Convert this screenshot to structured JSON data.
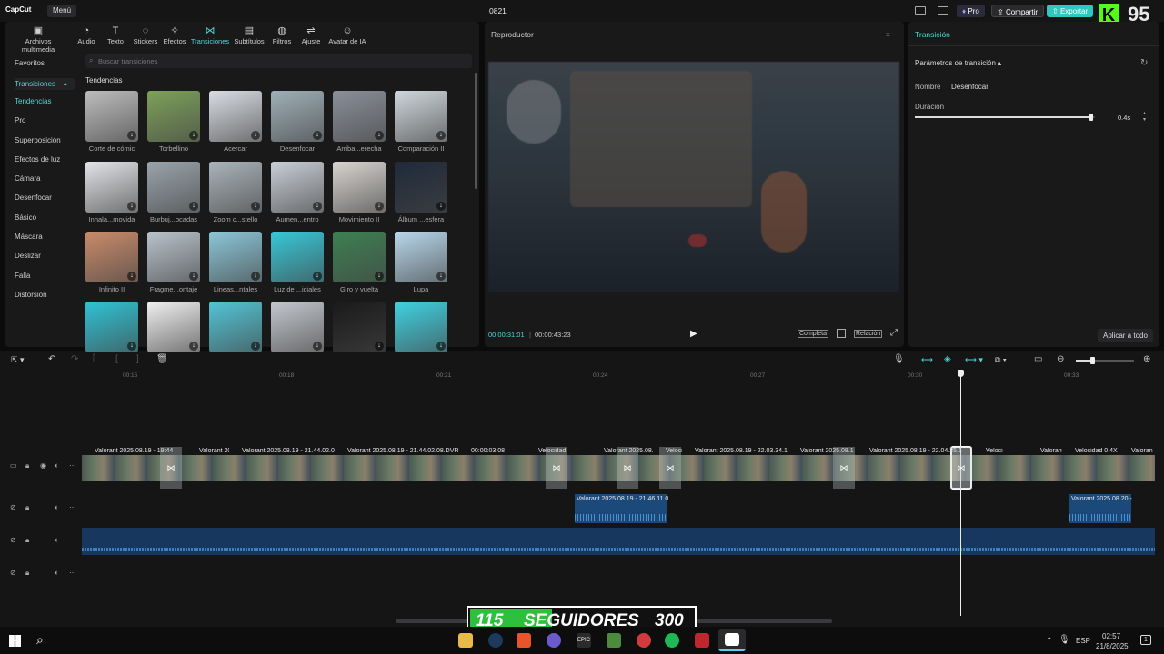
{
  "app": {
    "logo": "CapCut",
    "menu": "Menú",
    "project": "0821",
    "pro": "Pro",
    "share": "Compartir",
    "export": "Exportar",
    "overlay_score": "95"
  },
  "tools": [
    {
      "label": "Archivos multimedia",
      "icon": "media-icon"
    },
    {
      "label": "Audio",
      "icon": "audio-icon"
    },
    {
      "label": "Texto",
      "icon": "text-icon"
    },
    {
      "label": "Stickers",
      "icon": "sticker-icon"
    },
    {
      "label": "Efectos",
      "icon": "effects-icon"
    },
    {
      "label": "Transiciones",
      "icon": "transition-icon"
    },
    {
      "label": "Subtítulos",
      "icon": "subtitles-icon"
    },
    {
      "label": "Filtros",
      "icon": "filters-icon"
    },
    {
      "label": "Ajuste",
      "icon": "adjust-icon"
    },
    {
      "label": "Avatar de IA",
      "icon": "avatar-icon"
    }
  ],
  "categories": [
    {
      "label": "Favoritos"
    },
    {
      "label": "Transiciones"
    },
    {
      "label": "Tendencias"
    },
    {
      "label": "Pro"
    },
    {
      "label": "Superposición"
    },
    {
      "label": "Efectos de luz"
    },
    {
      "label": "Cámara"
    },
    {
      "label": "Desenfocar"
    },
    {
      "label": "Básico"
    },
    {
      "label": "Máscara"
    },
    {
      "label": "Deslizar"
    },
    {
      "label": "Falla"
    },
    {
      "label": "Distorsión"
    }
  ],
  "search": {
    "placeholder": "Buscar transiciones"
  },
  "section_title": "Tendencias",
  "thumbs": [
    {
      "label": "Corte de cómic",
      "color": "#bdbdbd"
    },
    {
      "label": "Torbellino",
      "color": "#7da15a"
    },
    {
      "label": "Acercar",
      "color": "#d9dde3"
    },
    {
      "label": "Desenfocar",
      "color": "#9fb0b8"
    },
    {
      "label": "Arriba...erecha",
      "color": "#8a8f99"
    },
    {
      "label": "Comparación II",
      "color": "#cfd7dc"
    },
    {
      "label": "Inhala...movida",
      "color": "#e2e4e8"
    },
    {
      "label": "Burbuj...ocadas",
      "color": "#9aa4ab"
    },
    {
      "label": "Zoom c...stello",
      "color": "#aab4ba"
    },
    {
      "label": "Aumen...entro",
      "color": "#c9cfd6"
    },
    {
      "label": "Movimiento II",
      "color": "#d8d4d0"
    },
    {
      "label": "Álbum ...esfera",
      "color": "#1f2a3a"
    },
    {
      "label": "Infinito II",
      "color": "#c98b6a"
    },
    {
      "label": "Fragme...ontaje",
      "color": "#b9c3cc"
    },
    {
      "label": "Lineas...ntales",
      "color": "#8cc6d8"
    },
    {
      "label": "Luz de ...iciales",
      "color": "#36c8d8"
    },
    {
      "label": "Giro y vuelta",
      "color": "#3d7f52"
    },
    {
      "label": "Lupa",
      "color": "#b8d8ec"
    },
    {
      "label": "",
      "color": "#2fc3d4"
    },
    {
      "label": "",
      "color": "#f0f0f0"
    },
    {
      "label": "",
      "color": "#52c5d6"
    },
    {
      "label": "",
      "color": "#c4c8ce"
    },
    {
      "label": "",
      "color": "#1a1a1a"
    },
    {
      "label": "",
      "color": "#3fd2e2"
    }
  ],
  "player": {
    "title": "Reproductor",
    "time_current": "00:00:31:01",
    "time_total": "00:00:43:23",
    "btn_full": "Completa",
    "btn_ratio": "Relación"
  },
  "inspector": {
    "tab": "Transición",
    "section": "Parámetros de transición",
    "name_label": "Nombre",
    "name_value": "Desenfocar",
    "duration_label": "Duración",
    "duration_value": "0.4s",
    "duration_fraction": 0.98,
    "apply_all": "Aplicar a todo"
  },
  "ruler": [
    "00:15",
    "00:18",
    "00:21",
    "00:24",
    "00:27",
    "00:30",
    "00:33"
  ],
  "clips": [
    {
      "label": "Valorant 2025.08.19 - 19:44"
    },
    {
      "label": "Valorant 2025"
    },
    {
      "label": "Valorant 2025.08.19 - 21.44.02.08.DVR"
    },
    {
      "label": "Valorant 2025.08.19 - 21.44.02.08.DVR.mp4"
    },
    {
      "label": "00:00:03:08"
    },
    {
      "label": "Velocidad"
    },
    {
      "label": "Valorant 2025.08.19"
    },
    {
      "label": "Veloci"
    },
    {
      "label": "Valorant 2025.08.19 - 22.03.34.10"
    },
    {
      "label": "Valorant 2025.08.1"
    },
    {
      "label": "Valorant 2025.08.19 - 22.04.25.1"
    },
    {
      "label": "Veloci"
    },
    {
      "label": "Valorant 2025.0"
    },
    {
      "label": "Velocidad 0.4X"
    },
    {
      "label": "Valoran"
    }
  ],
  "audio_clips": [
    {
      "label": "Valorant 2025.08.19 - 21.46.11.0"
    },
    {
      "label": "Valorant 2025.08.20 -"
    }
  ],
  "banner": {
    "left": "115",
    "center": "SEGUIDORES",
    "right": "300"
  },
  "taskbar": {
    "lang": "ESP",
    "time": "02:57",
    "date": "21/8/2025",
    "notif": "1"
  }
}
